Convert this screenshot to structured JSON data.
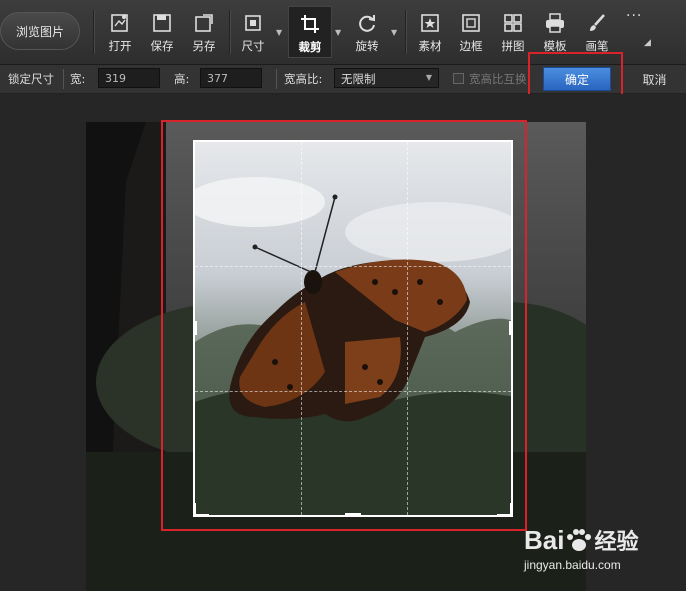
{
  "toolbar": {
    "browse_label": "浏览图片",
    "tools": [
      {
        "id": "open",
        "label": "打开",
        "icon": "open-icon"
      },
      {
        "id": "save",
        "label": "保存",
        "icon": "save-icon"
      },
      {
        "id": "saveas",
        "label": "另存",
        "icon": "save-as-icon"
      },
      {
        "id": "size",
        "label": "尺寸",
        "icon": "resize-icon"
      },
      {
        "id": "crop",
        "label": "裁剪",
        "icon": "crop-icon"
      },
      {
        "id": "rotate",
        "label": "旋转",
        "icon": "rotate-icon"
      },
      {
        "id": "material",
        "label": "素材",
        "icon": "star-icon"
      },
      {
        "id": "border",
        "label": "边框",
        "icon": "border-icon"
      },
      {
        "id": "collage",
        "label": "拼图",
        "icon": "grid-icon"
      },
      {
        "id": "template",
        "label": "模板",
        "icon": "printer-icon"
      },
      {
        "id": "brush",
        "label": "画笔",
        "icon": "brush-icon"
      }
    ],
    "more_label": "···"
  },
  "options": {
    "lock_label": "锁定尺寸",
    "width_label": "宽:",
    "width_value": "319",
    "height_label": "高:",
    "height_value": "377",
    "ratio_label": "宽高比:",
    "ratio_value": "无限制",
    "swap_label": "宽高比互换",
    "ok_label": "确定",
    "cancel_label": "取消"
  },
  "watermark": {
    "brand": "Bai",
    "brand2": "经验",
    "url": "jingyan.baidu.com"
  },
  "colors": {
    "accent": "#2f74d0",
    "highlight": "#d9232a"
  }
}
